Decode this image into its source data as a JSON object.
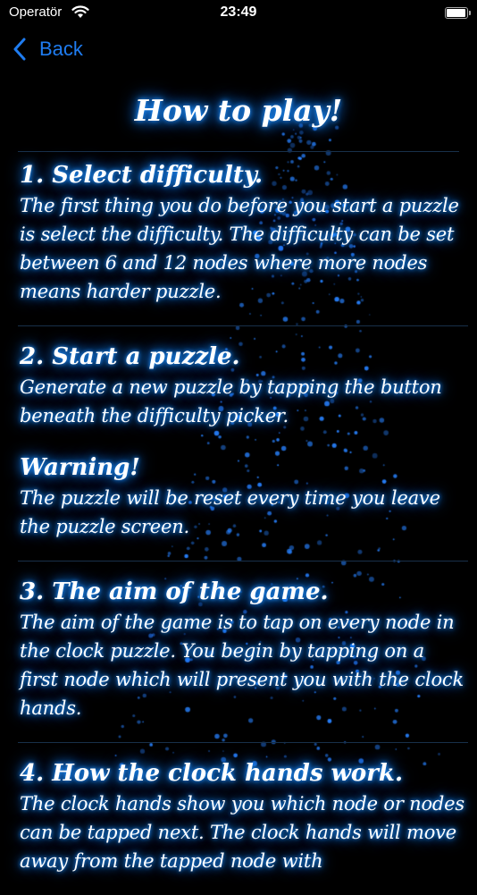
{
  "status_bar": {
    "carrier": "Operatör",
    "time": "23:49",
    "battery_level": 0.95
  },
  "nav": {
    "back_label": "Back",
    "accent_color": "#1f7cf0"
  },
  "page": {
    "title": "How to play!",
    "glow_color": "#1e90ff"
  },
  "sections": [
    {
      "heading": "1. Select difficulty.",
      "body": "The first thing you do before you start a puzzle is select the difficulty. The difficulty can be set between 6 and 12 nodes where more nodes means harder puzzle."
    },
    {
      "heading": "2. Start a puzzle.",
      "body": "Generate a new puzzle by tapping the button beneath the difficulty picker."
    },
    {
      "heading": "Warning!",
      "body": "The puzzle will be reset every time you leave the puzzle screen."
    },
    {
      "heading": "3. The aim of the game.",
      "body": "The aim of the game is to tap on every node in the clock puzzle. You begin by tapping on a first node which will present you with the clock hands."
    },
    {
      "heading": "4. How the clock hands work.",
      "body": "The clock hands show you which node or nodes can be tapped next. The clock hands will move away from the tapped node with"
    }
  ]
}
